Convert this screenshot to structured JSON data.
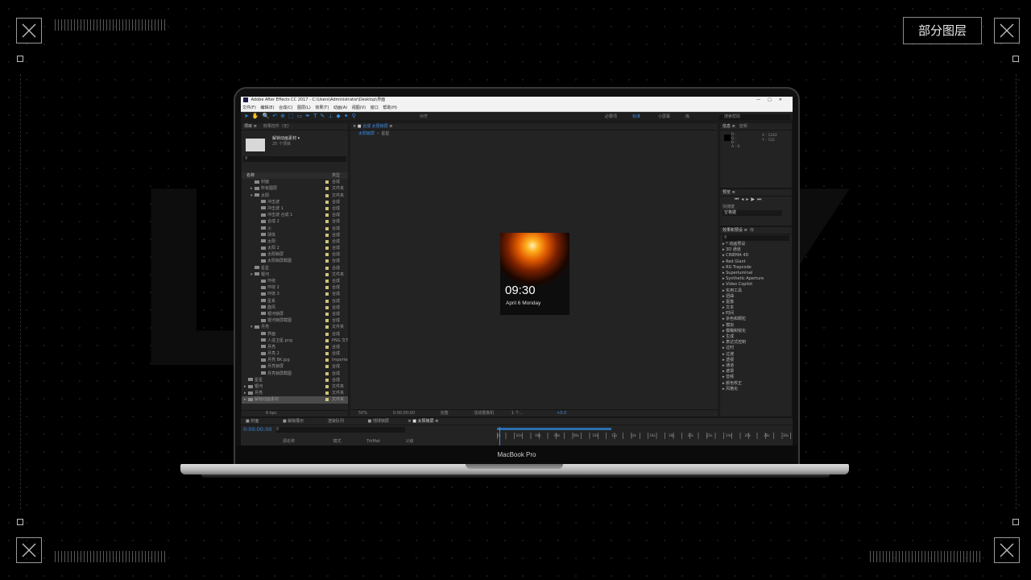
{
  "badge_label": "部分图层",
  "background_text": "LAYER",
  "laptop": {
    "brand_label": "MacBook Pro"
  },
  "ae": {
    "title": "Adobe After Effects CC 2017 - C:\\Users\\Administrator\\Desktop\\界面",
    "window_controls": [
      "—",
      "□",
      "✕"
    ],
    "menu": [
      "文件(F)",
      "编辑(E)",
      "合成(C)",
      "图层(L)",
      "效果(T)",
      "动画(A)",
      "视图(V)",
      "窗口",
      "帮助(H)"
    ],
    "toolbar": {
      "align_label": "对齐",
      "workspaces": [
        "必要项",
        "标准",
        "小屏幕",
        "库"
      ],
      "active_workspace": "标准",
      "search_placeholder": "搜索帮助"
    },
    "project": {
      "tab": "项目",
      "effects_tab": "效果控件（无）",
      "selected_name": "解锁动画素材 ▾",
      "selected_info": "25 个项目",
      "columns": [
        "名称",
        "类型"
      ],
      "rows": [
        {
          "name": "封面",
          "type": "合成",
          "indent": 1,
          "arrow": ""
        },
        {
          "name": "所有图层",
          "type": "文件夹",
          "indent": 1,
          "arrow": "▸"
        },
        {
          "name": "太阳",
          "type": "文件夹",
          "indent": 1,
          "arrow": "▾"
        },
        {
          "name": "冲击波",
          "type": "合成",
          "indent": 2,
          "arrow": ""
        },
        {
          "name": "冲击波 1",
          "type": "合成",
          "indent": 2,
          "arrow": ""
        },
        {
          "name": "冲击波 合成 1",
          "type": "合成",
          "indent": 2,
          "arrow": ""
        },
        {
          "name": "合成 2",
          "type": "合成",
          "indent": 2,
          "arrow": ""
        },
        {
          "name": "火",
          "type": "合成",
          "indent": 2,
          "arrow": ""
        },
        {
          "name": "球体",
          "type": "合成",
          "indent": 2,
          "arrow": ""
        },
        {
          "name": "太阳",
          "type": "合成",
          "indent": 2,
          "arrow": ""
        },
        {
          "name": "太阳 2",
          "type": "合成",
          "indent": 2,
          "arrow": ""
        },
        {
          "name": "太阳锁屏",
          "type": "合成",
          "indent": 2,
          "arrow": ""
        },
        {
          "name": "太阳锁屏截图",
          "type": "合成",
          "indent": 2,
          "arrow": ""
        },
        {
          "name": "星星",
          "type": "合成",
          "indent": 1,
          "arrow": ""
        },
        {
          "name": "银河",
          "type": "文件夹",
          "indent": 1,
          "arrow": "▾"
        },
        {
          "name": "环绕",
          "type": "合成",
          "indent": 2,
          "arrow": ""
        },
        {
          "name": "环绕 2",
          "type": "合成",
          "indent": 2,
          "arrow": ""
        },
        {
          "name": "环绕 3",
          "type": "合成",
          "indent": 2,
          "arrow": ""
        },
        {
          "name": "星系",
          "type": "合成",
          "indent": 2,
          "arrow": ""
        },
        {
          "name": "旋风",
          "type": "合成",
          "indent": 2,
          "arrow": ""
        },
        {
          "name": "银河锁屏",
          "type": "合成",
          "indent": 2,
          "arrow": ""
        },
        {
          "name": "银河锁屏截图",
          "type": "合成",
          "indent": 2,
          "arrow": ""
        },
        {
          "name": "月亮",
          "type": "文件夹",
          "indent": 1,
          "arrow": "▾"
        },
        {
          "name": "界面",
          "type": "合成",
          "indent": 2,
          "arrow": ""
        },
        {
          "name": "人造卫星.png",
          "type": "PNG 文件",
          "indent": 2,
          "arrow": ""
        },
        {
          "name": "月亮",
          "type": "合成",
          "indent": 2,
          "arrow": ""
        },
        {
          "name": "月亮 2",
          "type": "合成",
          "indent": 2,
          "arrow": ""
        },
        {
          "name": "月亮 BK.jpg",
          "type": "Importe",
          "indent": 2,
          "arrow": ""
        },
        {
          "name": "月亮锁屏",
          "type": "合成",
          "indent": 2,
          "arrow": ""
        },
        {
          "name": "月亮锁屏截图",
          "type": "合成",
          "indent": 2,
          "arrow": ""
        },
        {
          "name": "星星",
          "type": "合成",
          "indent": 0,
          "arrow": ""
        },
        {
          "name": "银河",
          "type": "文件夹",
          "indent": 0,
          "arrow": "▸"
        },
        {
          "name": "月亮",
          "type": "文件夹",
          "indent": 0,
          "arrow": "▸"
        },
        {
          "name": "解锁动画素材",
          "type": "文件夹",
          "indent": 0,
          "arrow": "▸",
          "selected": true
        }
      ],
      "footer": "8 bpc"
    },
    "composition": {
      "tab": "合成 太阳锁屏",
      "breadcrumbs": [
        "太阳锁屏",
        "星星"
      ],
      "clock": "09:30",
      "date": "April 6 Monday",
      "zoom": "50%",
      "timecode": "0:00:00:00",
      "resolution": "完整",
      "camera": "活动摄像机",
      "views": "1 个...",
      "exposure": "+0.0"
    },
    "info": {
      "tabs": [
        "信息",
        "音频"
      ],
      "rgba_labels": [
        "R :",
        "G :",
        "B :",
        "A : 0"
      ],
      "x": "X : 1242",
      "y": "Y : 722"
    },
    "preview": {
      "tab": "预览",
      "shortcut_label": "快捷键",
      "shortcut_value": "空格键"
    },
    "effects": {
      "tabs": [
        "效果和预设",
        "库"
      ],
      "items": [
        "* 动画预设",
        "3D 通道",
        "CINEMA 4D",
        "Red Giant",
        "RG Trapcode",
        "Superluminal",
        "Synthetic Aperture",
        "Video Copilot",
        "实用工具",
        "扭曲",
        "抠像",
        "文本",
        "时间",
        "杂色和颗粒",
        "模拟",
        "模糊和锐化",
        "生成",
        "表达式控制",
        "过时",
        "过渡",
        "透视",
        "通道",
        "遮罩",
        "音频",
        "颜色校正",
        "风格化"
      ]
    },
    "timeline": {
      "tabs": [
        "封面",
        "解锁展示",
        "渲染队列",
        "地球锁屏",
        "太阳锁屏"
      ],
      "timecode": "0:00:00:00",
      "column_source": "源名称",
      "column_mode": "模式",
      "column_trkmat": "TrkMat",
      "column_parent": "父级",
      "ruler_labels": [
        "0s",
        "02s",
        "04s",
        "06s",
        "08s",
        "10s",
        "12s",
        "14s",
        "16s",
        "18s",
        "20s",
        "22s",
        "24s",
        "26s",
        "28s",
        "30s"
      ]
    }
  },
  "colors": {
    "accent": "#2d8ceb",
    "sun": "#ff8c1a",
    "background": "#000000"
  }
}
